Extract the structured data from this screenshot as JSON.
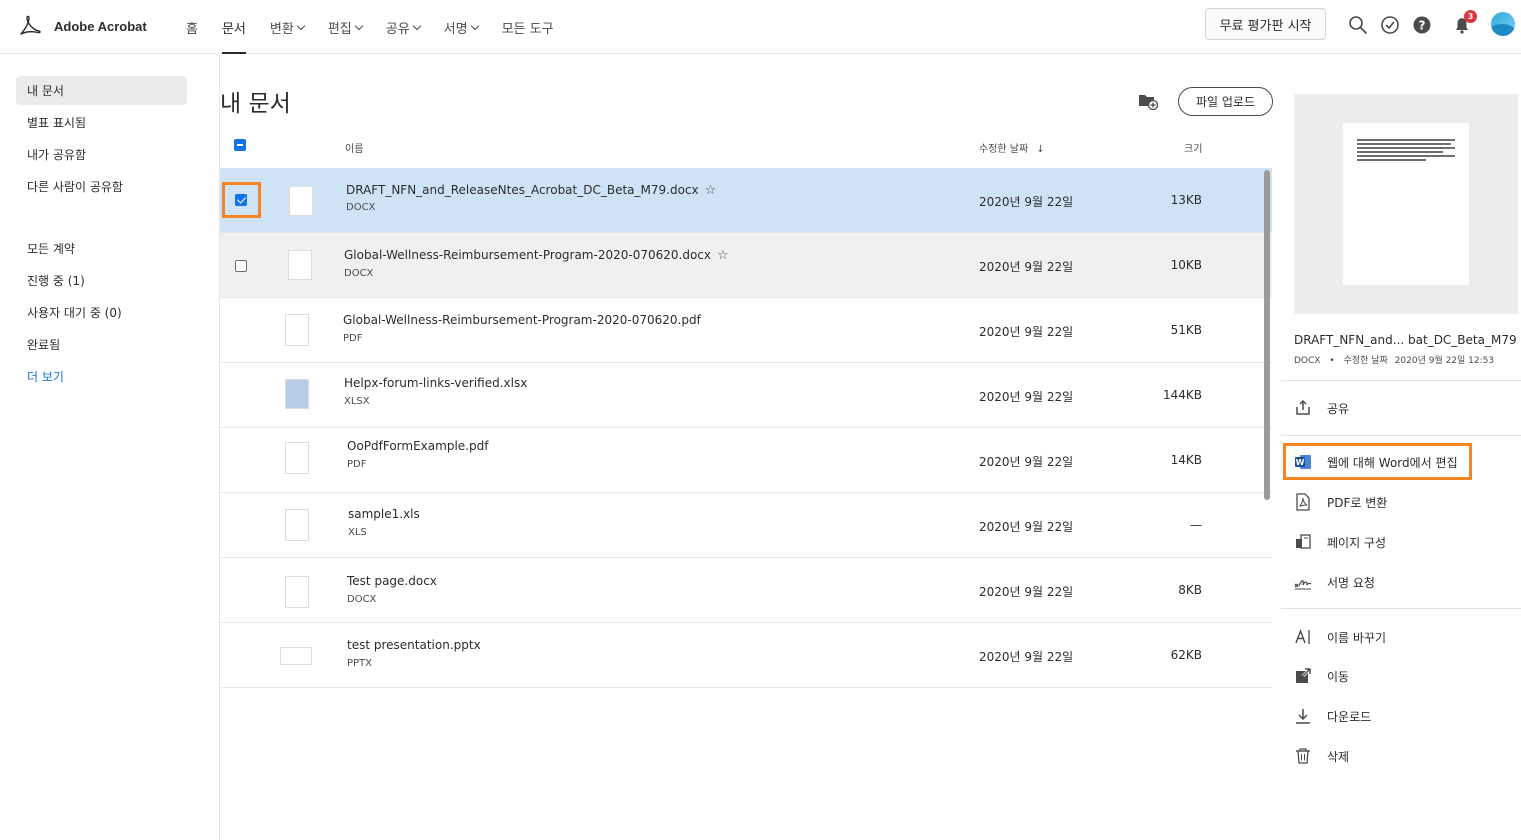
{
  "app": {
    "name": "Adobe Acrobat"
  },
  "topnav": [
    {
      "label": "홈",
      "dropdown": false,
      "active": false
    },
    {
      "label": "문서",
      "dropdown": false,
      "active": true
    },
    {
      "label": "변환",
      "dropdown": true,
      "active": false
    },
    {
      "label": "편집",
      "dropdown": true,
      "active": false
    },
    {
      "label": "공유",
      "dropdown": true,
      "active": false
    },
    {
      "label": "서명",
      "dropdown": true,
      "active": false
    },
    {
      "label": "모든 도구",
      "dropdown": false,
      "active": false
    }
  ],
  "header": {
    "trial_button": "무료 평가판 시작",
    "notification_count": "3"
  },
  "sidebar": {
    "items": [
      "내 문서",
      "별표 표시됨",
      "내가 공유함",
      "다른 사람이 공유함"
    ],
    "agreements": [
      "모든 계약",
      "진행 중 (1)",
      "사용자 대기 중 (0)",
      "완료됨"
    ],
    "more": "더 보기"
  },
  "main": {
    "title": "내 문서",
    "upload_button": "파일 업로드",
    "columns": {
      "name": "이름",
      "modified": "수정한 날짜",
      "size": "크기"
    },
    "files": [
      {
        "name": "DRAFT_NFN_and_ReleaseNtes_Acrobat_DC_Beta_M79.docx",
        "type": "DOCX",
        "date": "2020년 9월 22일",
        "size": "13KB",
        "star": "☆"
      },
      {
        "name": "Global-Wellness-Reimbursement-Program-2020-070620.docx",
        "type": "DOCX",
        "date": "2020년 9월 22일",
        "size": "10KB",
        "star": "☆"
      },
      {
        "name": "Global-Wellness-Reimbursement-Program-2020-070620.pdf",
        "type": "PDF",
        "date": "2020년 9월 22일",
        "size": "51KB"
      },
      {
        "name": "Helpx-forum-links-verified.xlsx",
        "type": "XLSX",
        "date": "2020년 9월 22일",
        "size": "144KB"
      },
      {
        "name": "OoPdfFormExample.pdf",
        "type": "PDF",
        "date": "2020년 9월 22일",
        "size": "14KB"
      },
      {
        "name": "sample1.xls",
        "type": "XLS",
        "date": "2020년 9월 22일",
        "size": "—"
      },
      {
        "name": "Test page.docx",
        "type": "DOCX",
        "date": "2020년 9월 22일",
        "size": "8KB"
      },
      {
        "name": "test presentation.pptx",
        "type": "PPTX",
        "date": "2020년 9월 22일",
        "size": "62KB"
      }
    ]
  },
  "right_panel": {
    "file_title": "DRAFT_NFN_and... bat_DC_Beta_M79",
    "file_type": "DOCX",
    "modified_label": "수정한 날짜",
    "modified_value": "2020년 9월 22일 12:53",
    "actions": {
      "share": "공유",
      "edit_word": "웹에 대해 Word에서 편집",
      "convert_pdf": "PDF로 변환",
      "organize_pages": "페이지 구성",
      "request_signature": "서명 요청",
      "rename": "이름 바꾸기",
      "move": "이동",
      "download": "다운로드",
      "delete": "삭제"
    }
  },
  "colors": {
    "accent": "#1473e6",
    "highlight": "#f68524",
    "selected_row": "#cfe3f7",
    "badge": "#d7373f"
  }
}
